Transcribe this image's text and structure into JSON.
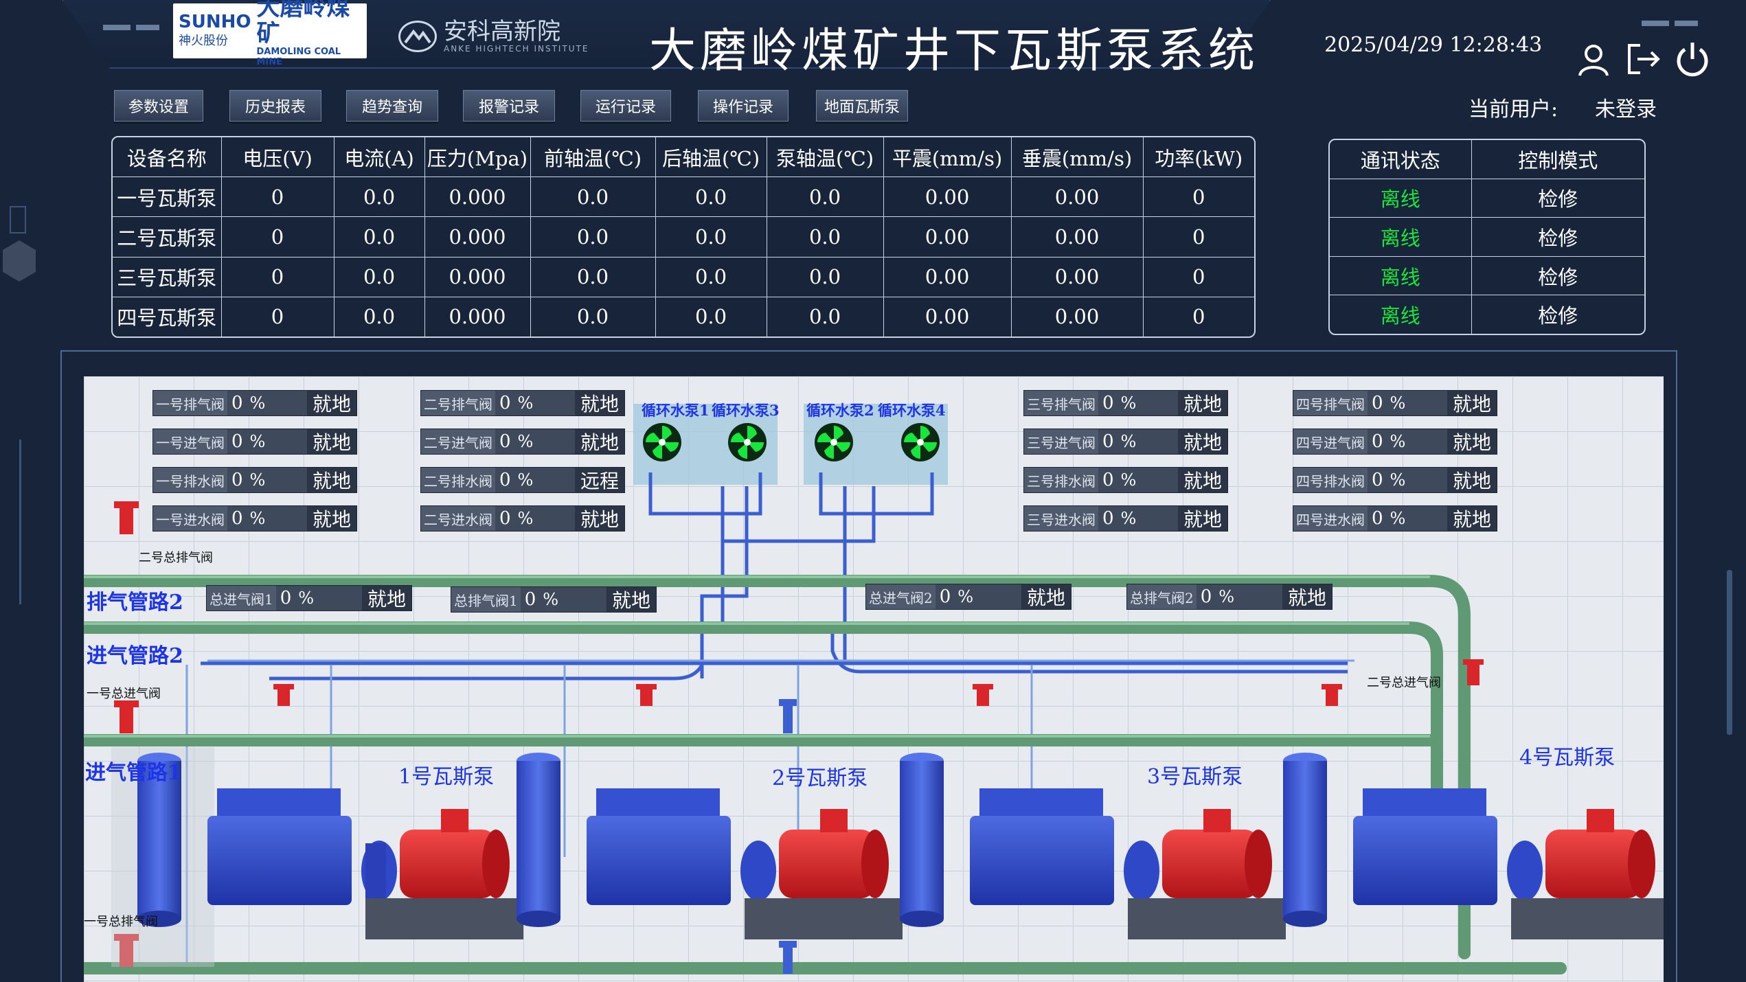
{
  "header": {
    "logo_sunho_en": "SUNHO",
    "logo_sunho_cn": "神火股份",
    "logo_damoling_cn": "大磨岭煤矿",
    "logo_damoling_en": "DAMOLING COAL MINE",
    "logo_anke_cn": "安科高新院",
    "logo_anke_en": "ANKE HIGHTECH INSTITUTE",
    "title": "大磨岭煤矿井下瓦斯泵系统",
    "datetime": "2025/04/29 12:28:43",
    "icons": [
      "user-icon",
      "logout-icon",
      "power-icon"
    ]
  },
  "nav": {
    "items": [
      {
        "label": "参数设置"
      },
      {
        "label": "历史报表"
      },
      {
        "label": "趋势查询"
      },
      {
        "label": "报警记录"
      },
      {
        "label": "运行记录"
      },
      {
        "label": "操作记录"
      },
      {
        "label": "地面瓦斯泵"
      }
    ],
    "user_label": "当前用户:",
    "user_value": "未登录"
  },
  "params_table": {
    "headers": [
      "设备名称",
      "电压(V)",
      "电流(A)",
      "压力(Mpa)",
      "前轴温(℃)",
      "后轴温(℃)",
      "泵轴温(℃)",
      "平震(mm/s)",
      "垂震(mm/s)",
      "功率(kW)"
    ],
    "rows": [
      [
        "一号瓦斯泵",
        "0",
        "0.0",
        "0.000",
        "0.0",
        "0.0",
        "0.0",
        "0.00",
        "0.00",
        "0"
      ],
      [
        "二号瓦斯泵",
        "0",
        "0.0",
        "0.000",
        "0.0",
        "0.0",
        "0.0",
        "0.00",
        "0.00",
        "0"
      ],
      [
        "三号瓦斯泵",
        "0",
        "0.0",
        "0.000",
        "0.0",
        "0.0",
        "0.0",
        "0.00",
        "0.00",
        "0"
      ],
      [
        "四号瓦斯泵",
        "0",
        "0.0",
        "0.000",
        "0.0",
        "0.0",
        "0.0",
        "0.00",
        "0.00",
        "0"
      ]
    ]
  },
  "status_table": {
    "headers": [
      "通讯状态",
      "控制模式"
    ],
    "rows": [
      [
        "离线",
        "检修"
      ],
      [
        "离线",
        "检修"
      ],
      [
        "离线",
        "检修"
      ],
      [
        "离线",
        "检修"
      ]
    ],
    "offline_color": "#19e63c"
  },
  "valves": {
    "g1": [
      {
        "name": "一号排气阀",
        "value": "0",
        "unit": "%",
        "mode": "就地"
      },
      {
        "name": "一号进气阀",
        "value": "0",
        "unit": "%",
        "mode": "就地"
      },
      {
        "name": "一号排水阀",
        "value": "0",
        "unit": "%",
        "mode": "就地"
      },
      {
        "name": "一号进水阀",
        "value": "0",
        "unit": "%",
        "mode": "就地"
      }
    ],
    "g2": [
      {
        "name": "二号排气阀",
        "value": "0",
        "unit": "%",
        "mode": "就地"
      },
      {
        "name": "二号进气阀",
        "value": "0",
        "unit": "%",
        "mode": "就地"
      },
      {
        "name": "二号排水阀",
        "value": "0",
        "unit": "%",
        "mode": "远程"
      },
      {
        "name": "二号进水阀",
        "value": "0",
        "unit": "%",
        "mode": "就地"
      }
    ],
    "g3": [
      {
        "name": "三号排气阀",
        "value": "0",
        "unit": "%",
        "mode": "就地"
      },
      {
        "name": "三号进气阀",
        "value": "0",
        "unit": "%",
        "mode": "就地"
      },
      {
        "name": "三号排水阀",
        "value": "0",
        "unit": "%",
        "mode": "就地"
      },
      {
        "name": "三号进水阀",
        "value": "0",
        "unit": "%",
        "mode": "就地"
      }
    ],
    "g4": [
      {
        "name": "四号排气阀",
        "value": "0",
        "unit": "%",
        "mode": "就地"
      },
      {
        "name": "四号进气阀",
        "value": "0",
        "unit": "%",
        "mode": "就地"
      },
      {
        "name": "四号排水阀",
        "value": "0",
        "unit": "%",
        "mode": "就地"
      },
      {
        "name": "四号进水阀",
        "value": "0",
        "unit": "%",
        "mode": "就地"
      }
    ],
    "main": [
      {
        "name": "总进气阀1",
        "value": "0",
        "unit": "%",
        "mode": "就地"
      },
      {
        "name": "总排气阀1",
        "value": "0",
        "unit": "%",
        "mode": "就地"
      },
      {
        "name": "总进气阀2",
        "value": "0",
        "unit": "%",
        "mode": "就地"
      },
      {
        "name": "总排气阀2",
        "value": "0",
        "unit": "%",
        "mode": "就地"
      }
    ]
  },
  "circ_pumps": [
    "循环水泵1",
    "循环水泵3",
    "循环水泵2",
    "循环水泵4"
  ],
  "circ_labels": {
    "a": "循环水泵1",
    "b": "循环水泵3",
    "c": "循环水泵2",
    "d": "循环水泵4"
  },
  "pipes": {
    "exhaust2": "排气管路2",
    "intake2": "进气管路2",
    "intake1": "进气管路1"
  },
  "small_labels": {
    "exhaust_valve_2_total": "二号总排气阀",
    "intake_valve_1_total": "一号总进气阀",
    "intake_valve_2_total": "二号总进气阀",
    "exhaust_valve_1_total": "一号总排气阀"
  },
  "pumps": [
    "1号瓦斯泵",
    "2号瓦斯泵",
    "3号瓦斯泵",
    "4号瓦斯泵"
  ],
  "colors": {
    "background": "#18243a",
    "pipe_green": "#5f9a74",
    "pipe_blue": "#3b5fd0",
    "pump_blue": "#2f48c8",
    "motor_red": "#d8262a",
    "label_blue": "#1d35e6",
    "fan_green": "#19e63c"
  }
}
